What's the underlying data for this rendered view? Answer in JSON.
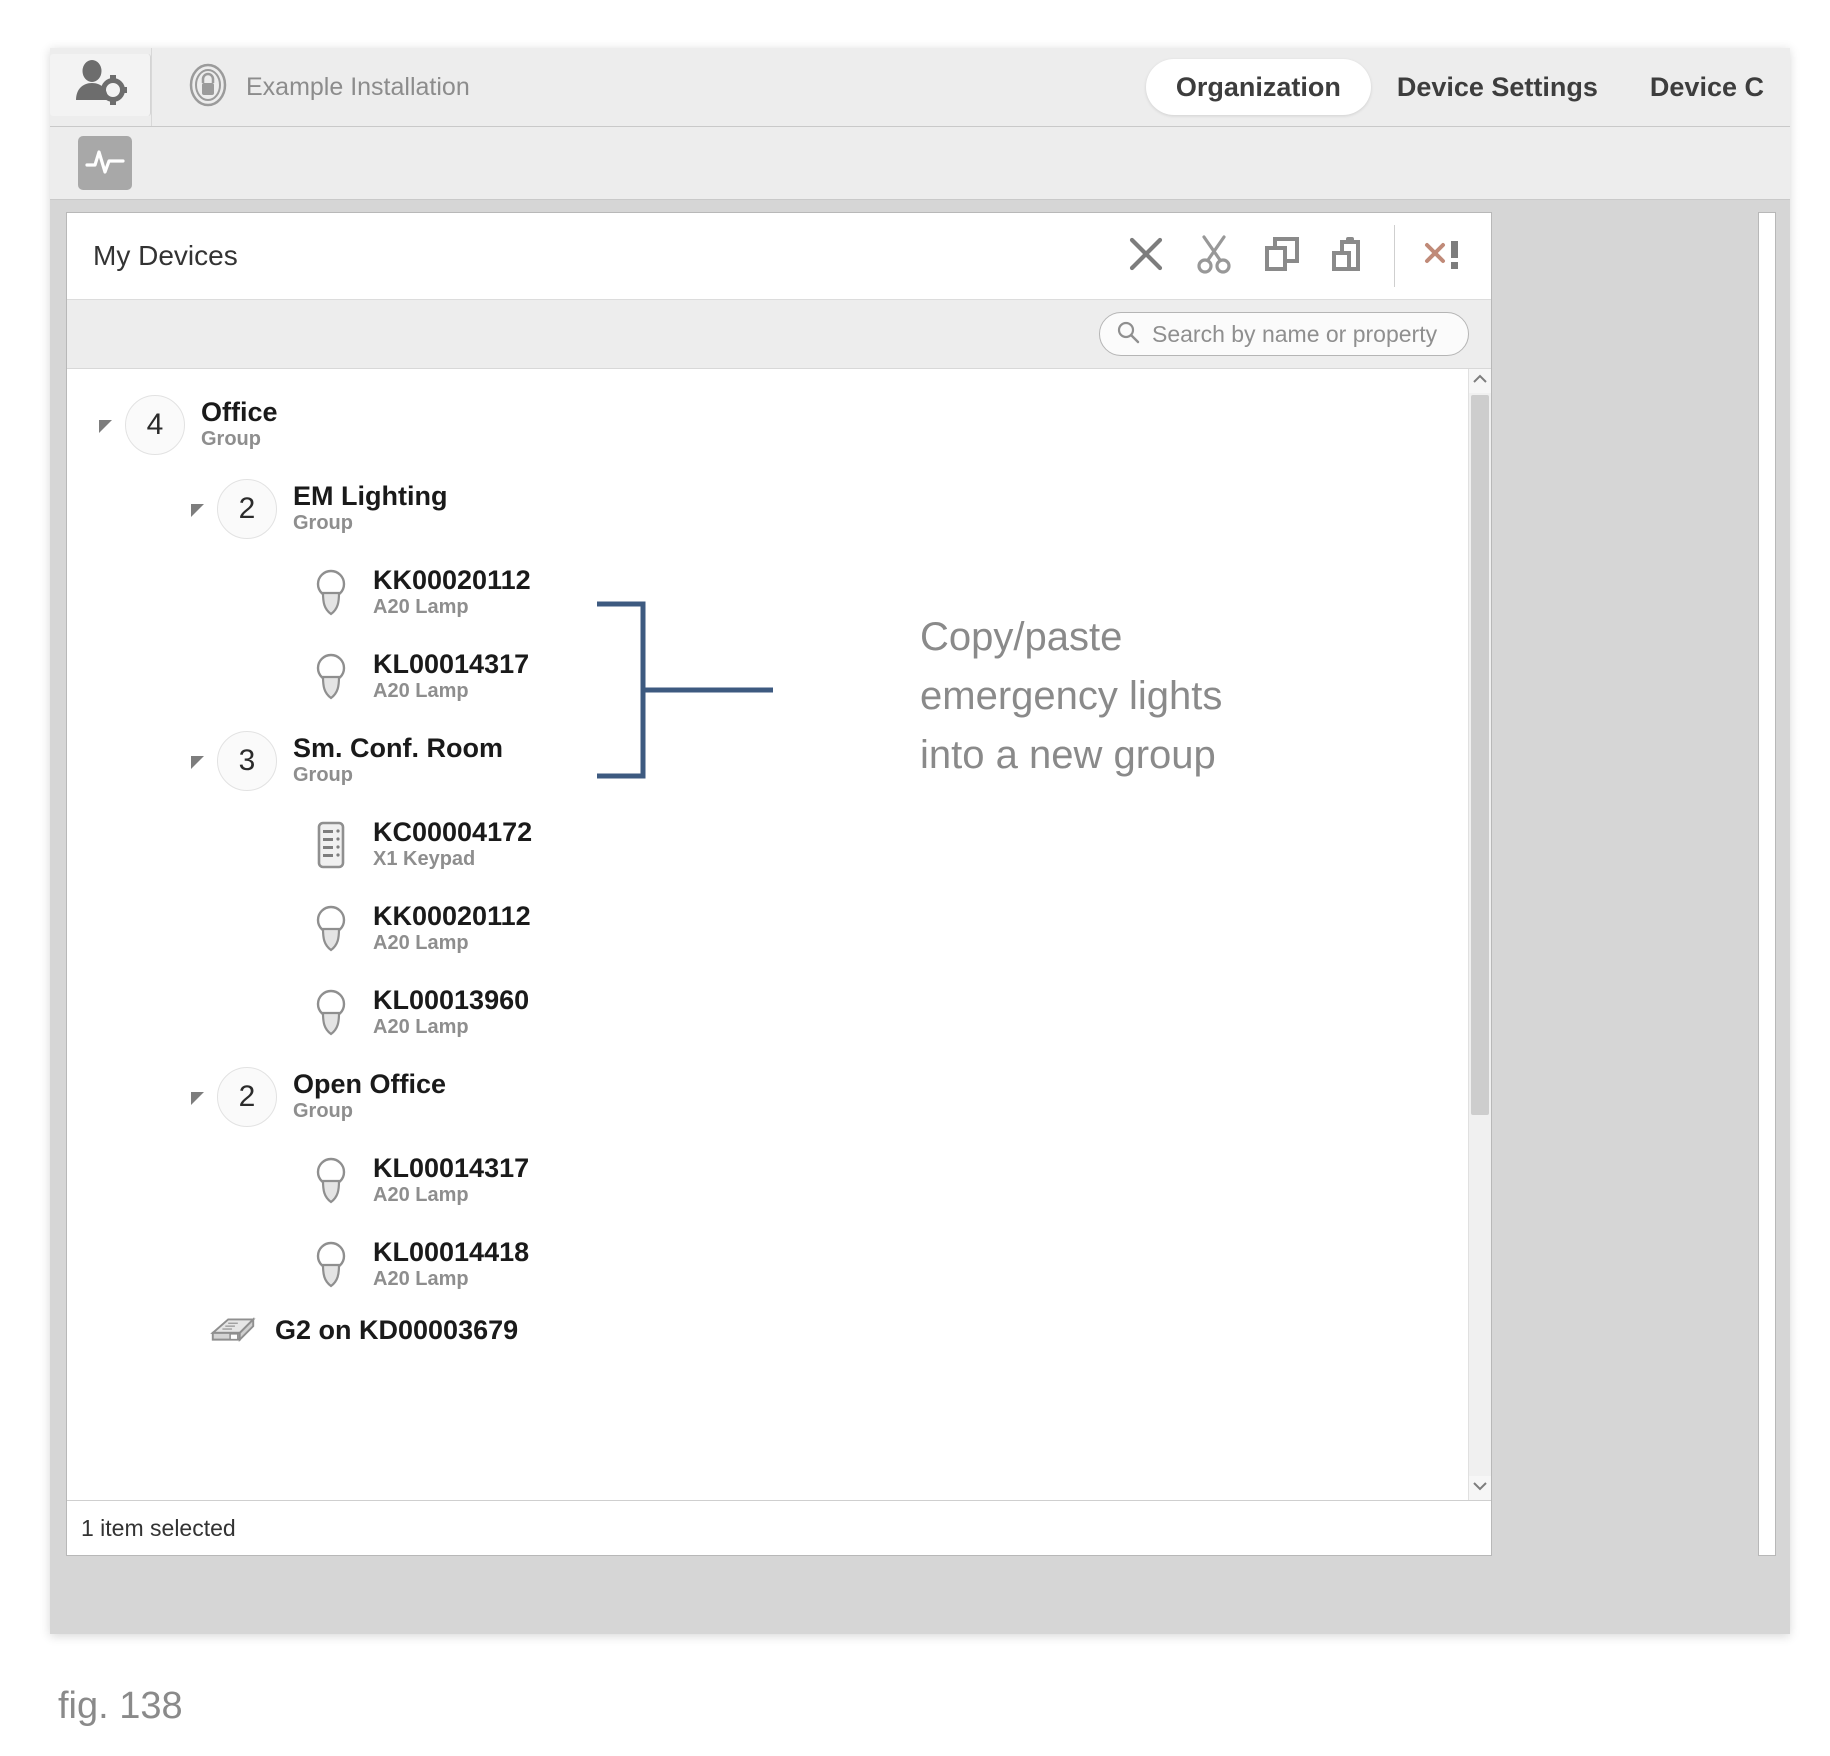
{
  "header": {
    "user_icon": "user-settings-icon",
    "installation_icon": "lock-badge-icon",
    "installation_label": "Example Installation",
    "tabs": [
      {
        "label": "Organization",
        "active": true
      },
      {
        "label": "Device Settings",
        "active": false
      },
      {
        "label": "Device C",
        "active": false
      }
    ]
  },
  "sub_toolbar": {
    "pulse_icon": "activity-pulse-icon"
  },
  "panel": {
    "title": "My Devices",
    "tools": [
      {
        "name": "delete-icon",
        "label": "Delete"
      },
      {
        "name": "cut-icon",
        "label": "Cut"
      },
      {
        "name": "copy-icon",
        "label": "Copy"
      },
      {
        "name": "paste-icon",
        "label": "Paste"
      },
      {
        "name": "error-icon",
        "label": "Errors"
      }
    ],
    "search": {
      "icon": "search-icon",
      "placeholder": "Search by name or property",
      "value": ""
    },
    "status": "1 item selected"
  },
  "tree": [
    {
      "indent": 0,
      "type": "group",
      "caret": "expanded",
      "count": "4",
      "name": "Office",
      "subtitle": "Group"
    },
    {
      "indent": 1,
      "type": "group",
      "caret": "expanded",
      "count": "2",
      "name": "EM Lighting",
      "subtitle": "Group"
    },
    {
      "indent": 2,
      "type": "device",
      "icon": "lamp-icon",
      "name": "KK00020112",
      "subtitle": "A20 Lamp"
    },
    {
      "indent": 2,
      "type": "device",
      "icon": "lamp-icon",
      "name": "KL00014317",
      "subtitle": "A20 Lamp"
    },
    {
      "indent": 1,
      "type": "group",
      "caret": "expanded",
      "count": "3",
      "name": "Sm. Conf. Room",
      "subtitle": "Group"
    },
    {
      "indent": 2,
      "type": "device",
      "icon": "keypad-icon",
      "name": "KC00004172",
      "subtitle": "X1 Keypad"
    },
    {
      "indent": 2,
      "type": "device",
      "icon": "lamp-icon",
      "name": "KK00020112",
      "subtitle": "A20 Lamp"
    },
    {
      "indent": 2,
      "type": "device",
      "icon": "lamp-icon",
      "name": "KL00013960",
      "subtitle": "A20 Lamp"
    },
    {
      "indent": 1,
      "type": "group",
      "caret": "expanded",
      "count": "2",
      "name": "Open Office",
      "subtitle": "Group"
    },
    {
      "indent": 2,
      "type": "device",
      "icon": "lamp-icon",
      "name": "KL00014317",
      "subtitle": "A20 Lamp"
    },
    {
      "indent": 2,
      "type": "device",
      "icon": "lamp-icon",
      "name": "KL00014418",
      "subtitle": "A20 Lamp"
    },
    {
      "indent": 1,
      "type": "gateway",
      "icon": "gateway-icon",
      "name": "G2 on KD00003679",
      "subtitle": ""
    }
  ],
  "annotation": {
    "line1": "Copy/paste",
    "line2": "emergency lights",
    "line3": "into a new group",
    "color": "#3d5a80"
  },
  "figure": {
    "caption": "fig. 138"
  }
}
